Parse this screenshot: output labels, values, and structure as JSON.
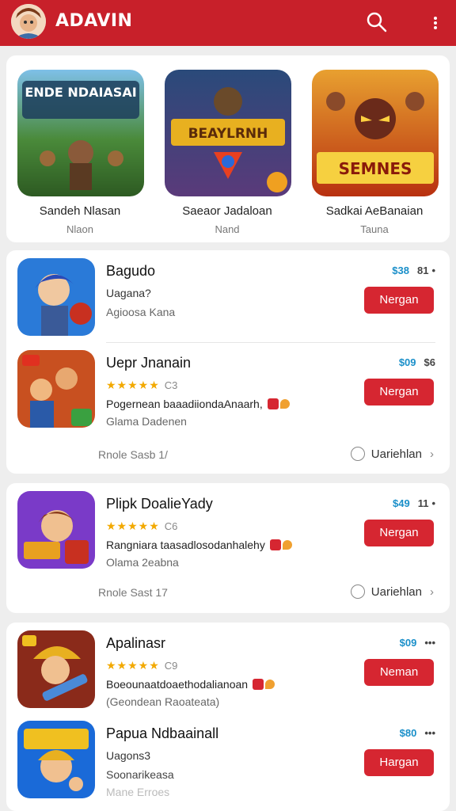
{
  "header": {
    "title": "ADAVIN",
    "avatar_icon": "user-avatar",
    "search_icon": "search-icon",
    "more_icon": "more-vert-icon",
    "bg_color": "#c8202a"
  },
  "featured": [
    {
      "name": "Sandeh Nlasan",
      "sub": "Nlaon",
      "art_title": "ENDE NDAIASAI"
    },
    {
      "name": "Saeaor Jadaloan",
      "sub": "Nand",
      "art_title": "BEAYLRNH"
    },
    {
      "name": "Sadkai AeBanaian",
      "sub": "Tauna",
      "art_title": "SEMNES"
    }
  ],
  "card1": {
    "apps": [
      {
        "name": "Bagudo",
        "line2": "Uagana?",
        "line3": "Agioosa Kana",
        "price": "$38",
        "extra": "81",
        "button": "Nergan"
      },
      {
        "name": "Uepr Jnanain",
        "stars": "★★★★★",
        "rating": "C3",
        "line3": "Pogernean baaadiiondaAnaarh,",
        "line4": "Glama Dadenen",
        "price": "$09",
        "extra": "$6",
        "button": "Nergan"
      }
    ],
    "footer_left": "Rnole Sasb 1/",
    "footer_right": "Uariehlan"
  },
  "card2": {
    "apps": [
      {
        "name": "Plipk DoalieYady",
        "stars": "★★★★★",
        "rating": "C6",
        "line3": "Rangniara  taasadlosodanhalehy",
        "line4": "Olama 2eabna",
        "price": "$49",
        "extra": "11",
        "button": "Nergan"
      }
    ],
    "footer_left": "Rnole Sast 17",
    "footer_right": "Uariehlan"
  },
  "card3": {
    "apps": [
      {
        "name": "Apalinasr",
        "stars": "★★★★★",
        "rating": "C9",
        "line3": "Boeounaatdoaethodalianoan",
        "line4": "(Geondean Raoateata)",
        "price": "$09",
        "extra": "•••",
        "button": "Neman"
      },
      {
        "name": "Papua Ndbaainall",
        "line2": "Uagons3",
        "line3": "Soonarikeasa",
        "line4": "Mane Erroes",
        "price": "$80",
        "extra": "•••",
        "button": "Hargan"
      }
    ]
  }
}
